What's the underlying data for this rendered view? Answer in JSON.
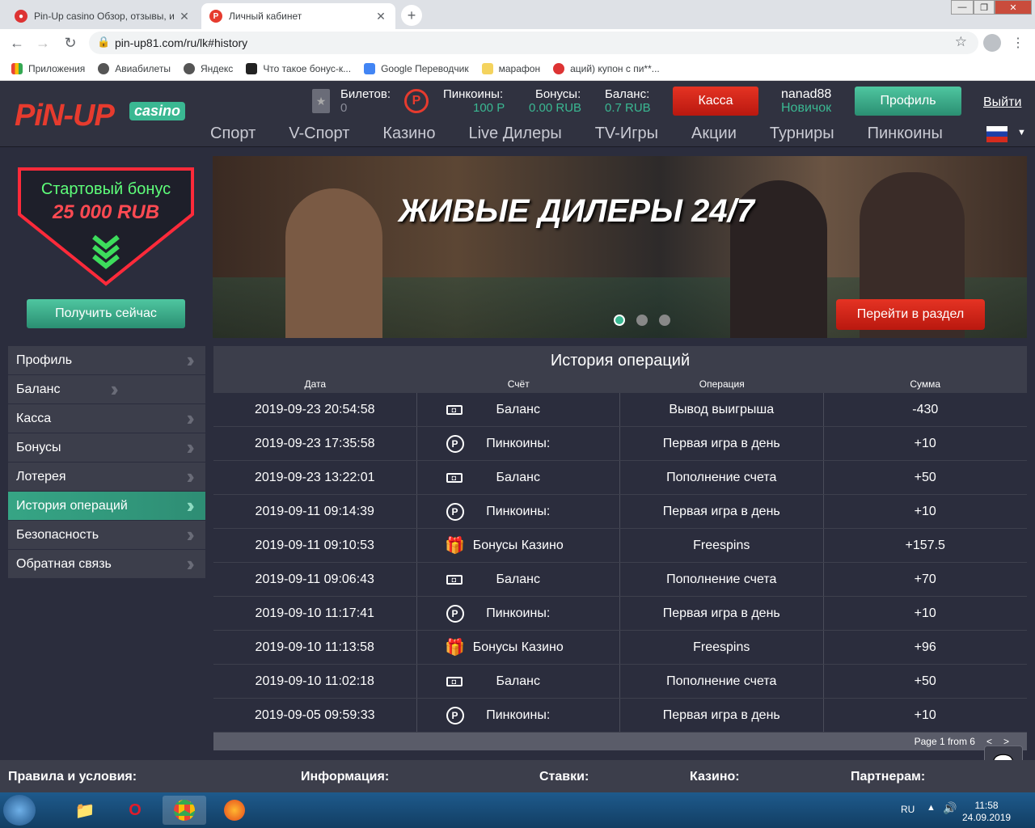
{
  "browser": {
    "tabs": [
      {
        "title": "Pin-Up casino Обзор, отзывы, и",
        "active": false
      },
      {
        "title": "Личный кабинет",
        "active": true
      }
    ],
    "new_tab": "+",
    "url": "pin-up81.com/ru/lk#history",
    "window_controls": {
      "min": "—",
      "max": "❐",
      "close": "✕"
    },
    "bookmarks": [
      "Приложения",
      "Авиабилеты",
      "Яндекс",
      "Что такое бонус-к...",
      "Google Переводчик",
      "марафон",
      "аций) купон с пи**..."
    ]
  },
  "header": {
    "logo": "PiN-UP",
    "logo_badge": "casino",
    "tickets": {
      "label": "Билетов:",
      "value": "0"
    },
    "pincoins": {
      "label": "Пинкоины:",
      "value": "100 P"
    },
    "bonuses": {
      "label": "Бонусы:",
      "value": "0.00 RUB"
    },
    "balance": {
      "label": "Баланс:",
      "value": "0.7 RUB"
    },
    "kassa_label": "Касса",
    "username": "nanad88",
    "user_level": "Новичок",
    "profile_label": "Профиль",
    "logout_label": "Выйти",
    "nav": [
      "Спорт",
      "V-Спорт",
      "Казино",
      "Live Дилеры",
      "TV-Игры",
      "Акции",
      "Турниры",
      "Пинкоины"
    ]
  },
  "promo": {
    "line1": "Стартовый бонус",
    "line2": "25 000 RUB",
    "button": "Получить сейчас"
  },
  "banner": {
    "title": "ЖИВЫЕ ДИЛЕРЫ 24/7",
    "button": "Перейти в раздел"
  },
  "sidebar": {
    "items": [
      {
        "label": "Профиль",
        "active": false
      },
      {
        "label": "Баланс",
        "active": false
      },
      {
        "label": "Касса",
        "active": false
      },
      {
        "label": "Бонусы",
        "active": false
      },
      {
        "label": "Лотерея",
        "active": false
      },
      {
        "label": "История операций",
        "active": true
      },
      {
        "label": "Безопасность",
        "active": false
      },
      {
        "label": "Обратная связь",
        "active": false
      }
    ]
  },
  "history": {
    "title": "История операций",
    "columns": [
      "Дата",
      "Счёт",
      "Операция",
      "Сумма"
    ],
    "rows": [
      {
        "date": "2019-09-23 20:54:58",
        "icon": "money-icon",
        "account": "Баланс",
        "operation": "Вывод выигрыша",
        "amount": "-430"
      },
      {
        "date": "2019-09-23 17:35:58",
        "icon": "pincoin-icon",
        "account": "Пинкоины:",
        "operation": "Первая игра в день",
        "amount": "+10"
      },
      {
        "date": "2019-09-23 13:22:01",
        "icon": "money-icon",
        "account": "Баланс",
        "operation": "Пополнение счета",
        "amount": "+50"
      },
      {
        "date": "2019-09-11 09:14:39",
        "icon": "pincoin-icon",
        "account": "Пинкоины:",
        "operation": "Первая игра в день",
        "amount": "+10"
      },
      {
        "date": "2019-09-11 09:10:53",
        "icon": "gift-icon",
        "account": "Бонусы Казино",
        "operation": "Freespins",
        "amount": "+157.5"
      },
      {
        "date": "2019-09-11 09:06:43",
        "icon": "money-icon",
        "account": "Баланс",
        "operation": "Пополнение счета",
        "amount": "+70"
      },
      {
        "date": "2019-09-10 11:17:41",
        "icon": "pincoin-icon",
        "account": "Пинкоины:",
        "operation": "Первая игра в день",
        "amount": "+10"
      },
      {
        "date": "2019-09-10 11:13:58",
        "icon": "gift-icon",
        "account": "Бонусы Казино",
        "operation": "Freespins",
        "amount": "+96"
      },
      {
        "date": "2019-09-10 11:02:18",
        "icon": "money-icon",
        "account": "Баланс",
        "operation": "Пополнение счета",
        "amount": "+50"
      },
      {
        "date": "2019-09-05 09:59:33",
        "icon": "pincoin-icon",
        "account": "Пинкоины:",
        "operation": "Первая игра в день",
        "amount": "+10"
      }
    ],
    "pager": "Page 1 from 6",
    "prev": "<",
    "next": ">"
  },
  "footer": {
    "links": [
      "Правила и условия:",
      "Информация:",
      "Ставки:",
      "Казино:",
      "Партнерам:"
    ]
  },
  "taskbar": {
    "lang": "RU",
    "time": "11:58",
    "date": "24.09.2019"
  },
  "colors": {
    "accent_green": "#3ab892",
    "accent_red": "#e53323",
    "bg": "#2b2d3d"
  }
}
